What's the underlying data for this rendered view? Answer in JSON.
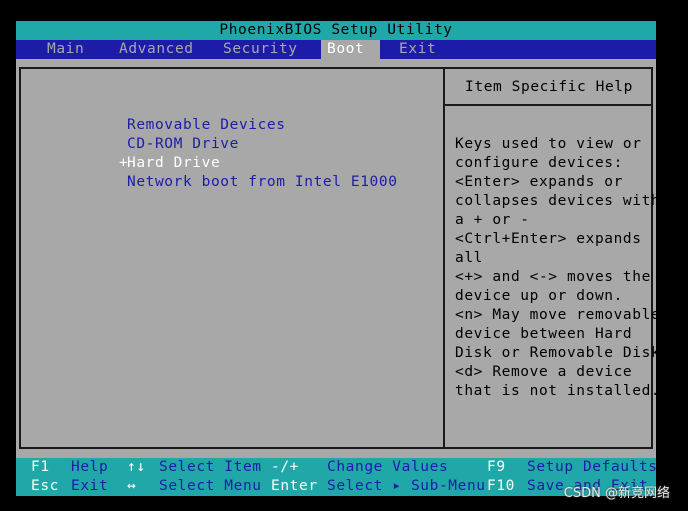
{
  "title": "PhoenixBIOS Setup Utility",
  "menu": {
    "main": "Main",
    "advanced": "Advanced",
    "security": "Security",
    "boot": "Boot",
    "exit": "Exit",
    "active": "Boot"
  },
  "boot_list": [
    {
      "prefix": "",
      "label": "Removable Devices"
    },
    {
      "prefix": "",
      "label": "CD-ROM Drive"
    },
    {
      "prefix": "+",
      "label": "Hard Drive"
    },
    {
      "prefix": "",
      "label": "Network boot from Intel E1000"
    }
  ],
  "selected_index": 2,
  "help": {
    "title": "Item Specific Help",
    "lines": [
      "Keys used to view or",
      "configure devices:",
      "<Enter> expands or",
      "collapses devices with",
      "a + or -",
      "<Ctrl+Enter> expands",
      "all",
      "<+> and <-> moves the",
      "device up or down.",
      "<n> May move removable",
      "device between Hard",
      "Disk or Removable Disk",
      "<d> Remove a device",
      "that is not installed."
    ]
  },
  "footer": {
    "row1": {
      "f1_key": "F1",
      "f1_desc": "Help",
      "arrows_key": "↑↓",
      "arrows_desc": "Select Item",
      "pm_key": "-/+",
      "pm_desc": "Change Values",
      "f9_key": "F9",
      "f9_desc": "Setup Defaults"
    },
    "row2": {
      "esc_key": "Esc",
      "esc_desc": "Exit",
      "lr_key": "↔",
      "lr_desc": "Select Menu",
      "enter_key": "Enter",
      "enter_desc": "Select ▸ Sub-Menu",
      "f10_key": "F10",
      "f10_desc": "Save and Exit"
    }
  },
  "watermark": "CSDN @新竞网络",
  "colors": {
    "cyan": "#20a8a8",
    "blue": "#1c1ca8",
    "gray": "#a8a8a8",
    "white": "#ffffff"
  }
}
